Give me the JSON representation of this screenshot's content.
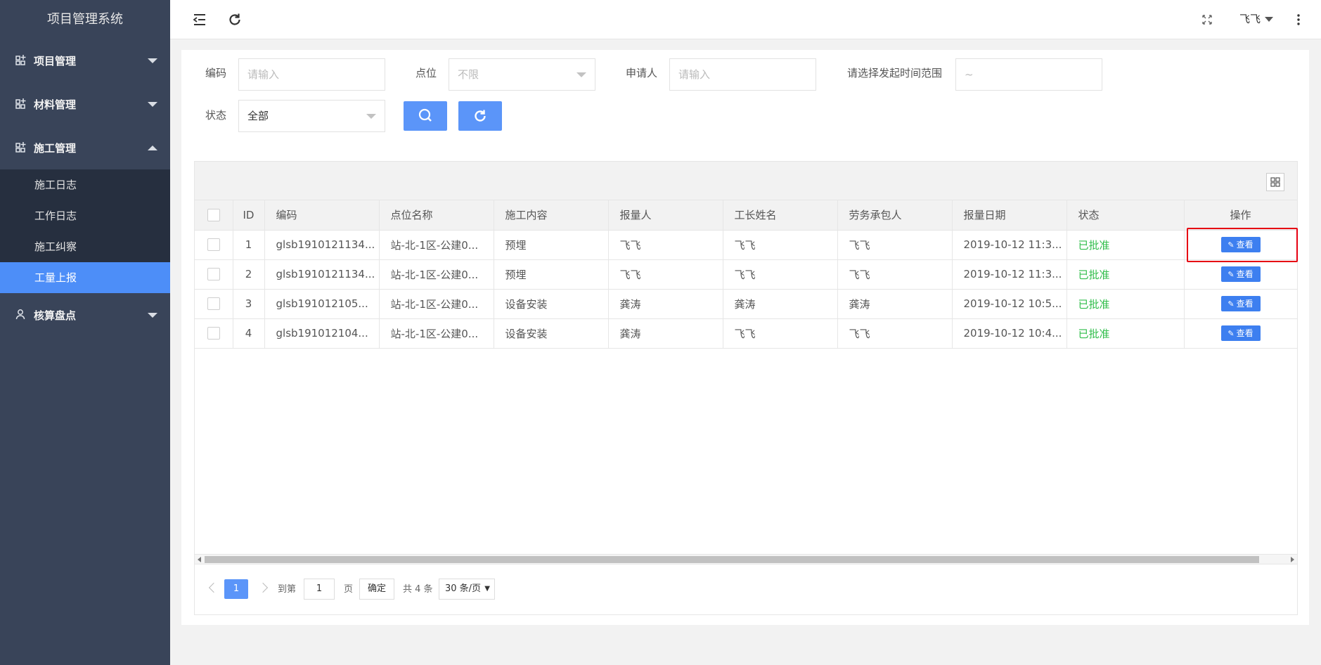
{
  "app": {
    "title": "项目管理系统"
  },
  "sidebar": {
    "items": [
      {
        "label": "项目管理",
        "expanded": false
      },
      {
        "label": "材料管理",
        "expanded": false
      },
      {
        "label": "施工管理",
        "expanded": true
      },
      {
        "label": "核算盘点",
        "expanded": false
      }
    ],
    "submenu": [
      {
        "label": "施工日志"
      },
      {
        "label": "工作日志"
      },
      {
        "label": "施工纠察"
      },
      {
        "label": "工量上报",
        "active": true
      }
    ]
  },
  "header": {
    "user": "飞飞"
  },
  "filters": {
    "code_label": "编码",
    "code_placeholder": "请输入",
    "point_label": "点位",
    "point_value": "不限",
    "applicant_label": "申请人",
    "applicant_placeholder": "请输入",
    "time_label": "请选择发起时间范围",
    "time_value": "~",
    "status_label": "状态",
    "status_value": "全部"
  },
  "table": {
    "headers": [
      "ID",
      "编码",
      "点位名称",
      "施工内容",
      "报量人",
      "工长姓名",
      "劳务承包人",
      "报量日期",
      "状态",
      "操作"
    ],
    "rows": [
      {
        "id": "1",
        "code": "glsb1910121134...",
        "point": "站-北-1区-公建0...",
        "content": "预埋",
        "reporter": "飞飞",
        "foreman": "飞飞",
        "contractor": "飞飞",
        "date": "2019-10-12 11:3...",
        "status": "已批准",
        "action": "查看"
      },
      {
        "id": "2",
        "code": "glsb1910121134...",
        "point": "站-北-1区-公建0...",
        "content": "预埋",
        "reporter": "飞飞",
        "foreman": "飞飞",
        "contractor": "飞飞",
        "date": "2019-10-12 11:3...",
        "status": "已批准",
        "action": "查看"
      },
      {
        "id": "3",
        "code": "glsb191012105...",
        "point": "站-北-1区-公建0...",
        "content": "设备安装",
        "reporter": "龚涛",
        "foreman": "龚涛",
        "contractor": "龚涛",
        "date": "2019-10-12 10:5...",
        "status": "已批准",
        "action": "查看"
      },
      {
        "id": "4",
        "code": "glsb191012104...",
        "point": "站-北-1区-公建0...",
        "content": "设备安装",
        "reporter": "龚涛",
        "foreman": "飞飞",
        "contractor": "飞飞",
        "date": "2019-10-12 10:4...",
        "status": "已批准",
        "action": "查看"
      }
    ]
  },
  "pagination": {
    "current_page": "1",
    "goto_label": "到第",
    "goto_value": "1",
    "page_unit": "页",
    "confirm": "确定",
    "total": "共 4 条",
    "page_size": "30 条/页"
  },
  "colors": {
    "accent": "#4d8ef8",
    "sidebar": "#394459",
    "submenu": "#262f3f",
    "status_ok": "#2fbd4a",
    "highlight": "#e60012"
  }
}
